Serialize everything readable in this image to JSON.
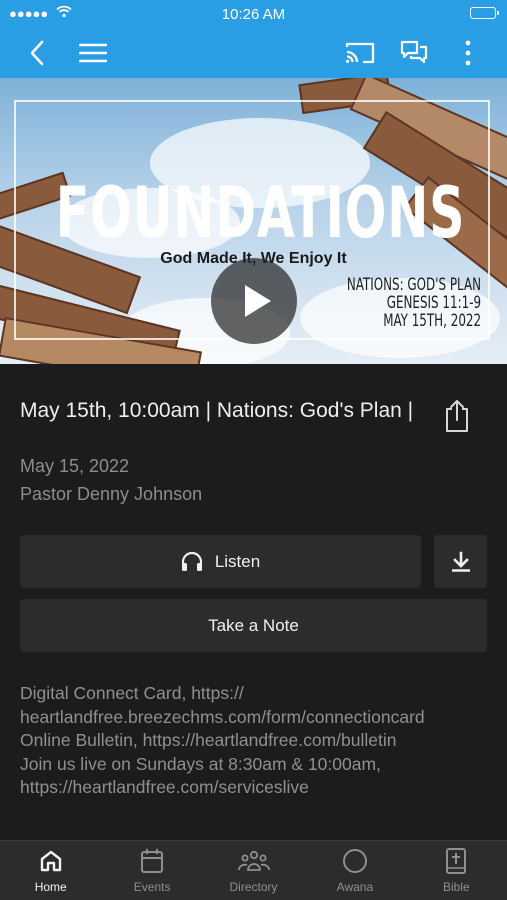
{
  "status_bar": {
    "time": "10:26 AM",
    "signal": "●●●●●"
  },
  "nav": {
    "back_icon": "chevron-left-icon",
    "menu_icon": "hamburger-icon",
    "cast_icon": "cast-icon",
    "chat_icon": "chat-icon",
    "more_icon": "more-vertical-icon",
    "accent_color": "#2a9ee4"
  },
  "hero": {
    "title": "FOUNDATIONS",
    "subtitle": "God Made It, We Enjoy It",
    "info_lines": [
      "NATIONS: GOD'S PLAN",
      "GENESIS 11:1-9",
      "MAY 15TH, 2022"
    ],
    "play_icon": "play-icon"
  },
  "sermon": {
    "title": "May 15th, 10:00am | Nations: God's Plan |",
    "date": "May 15, 2022",
    "speaker": "Pastor Denny Johnson",
    "share_icon": "share-icon"
  },
  "actions": {
    "listen_label": "Listen",
    "download_icon": "download-icon",
    "note_label": "Take a Note"
  },
  "description": "Digital Connect Card, https://\nheartlandfree.breezechms.com/form/connectioncard\nOnline Bulletin, https://heartlandfree.com/bulletin\nJoin us live on Sundays at 8:30am & 10:00am,\nhttps://heartlandfree.com/serviceslive",
  "tabs": [
    {
      "label": "Home",
      "icon": "home-icon",
      "active": true
    },
    {
      "label": "Events",
      "icon": "calendar-icon",
      "active": false
    },
    {
      "label": "Directory",
      "icon": "people-icon",
      "active": false
    },
    {
      "label": "Awana",
      "icon": "circle-icon",
      "active": false
    },
    {
      "label": "Bible",
      "icon": "bible-icon",
      "active": false
    }
  ]
}
